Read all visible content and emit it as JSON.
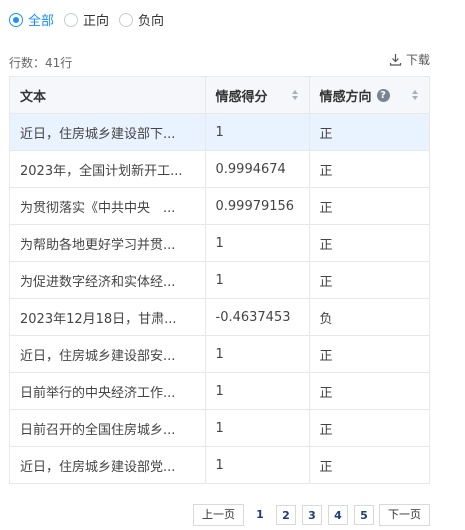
{
  "filters": {
    "options": [
      {
        "label": "全部",
        "checked": true
      },
      {
        "label": "正向",
        "checked": false
      },
      {
        "label": "负向",
        "checked": false
      }
    ]
  },
  "toolbar": {
    "row_count": "行数：41行",
    "download_label": "下载"
  },
  "table": {
    "headers": {
      "text": "文本",
      "score": "情感得分",
      "direction": "情感方向"
    },
    "rows": [
      {
        "text": "近日，住房城乡建设部下...",
        "score": "1",
        "direction": "正"
      },
      {
        "text": "2023年，全国计划新开工...",
        "score": "0.9994674",
        "direction": "正"
      },
      {
        "text": "为贯彻落实《中共中央　...",
        "score": "0.99979156",
        "direction": "正"
      },
      {
        "text": "为帮助各地更好学习并贯...",
        "score": "1",
        "direction": "正"
      },
      {
        "text": "为促进数字经济和实体经...",
        "score": "1",
        "direction": "正"
      },
      {
        "text": "2023年12月18日，甘肃...",
        "score": "-0.4637453",
        "direction": "负"
      },
      {
        "text": "近日，住房城乡建设部安...",
        "score": "1",
        "direction": "正"
      },
      {
        "text": "日前举行的中央经济工作...",
        "score": "1",
        "direction": "正"
      },
      {
        "text": "日前召开的全国住房城乡...",
        "score": "1",
        "direction": "正"
      },
      {
        "text": "近日，住房城乡建设部党...",
        "score": "1",
        "direction": "正"
      }
    ]
  },
  "pagination": {
    "prev_label": "上一页",
    "pages": [
      "1",
      "2",
      "3",
      "4",
      "5"
    ],
    "next_label": "下一页"
  },
  "colors": {
    "accent": "#1890ff",
    "selected_row": "#e8f3ff",
    "header_bg": "#f5f7fa"
  }
}
